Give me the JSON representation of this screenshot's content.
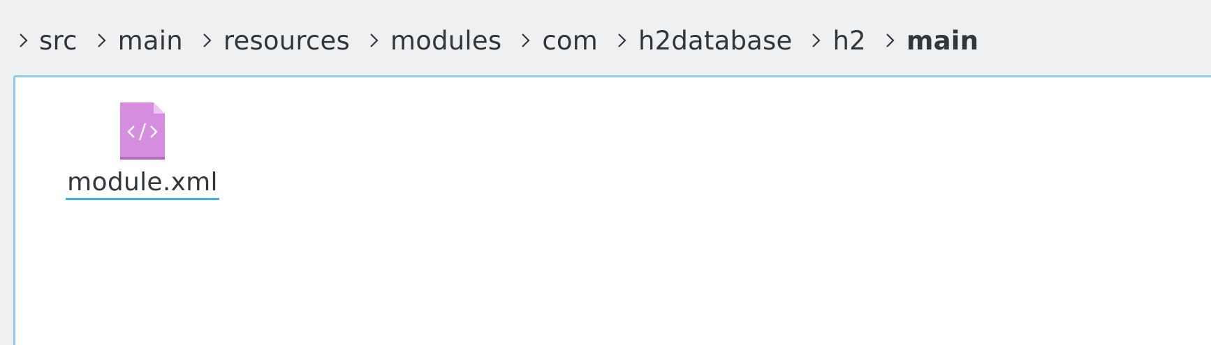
{
  "breadcrumb": {
    "items": [
      {
        "label": "src"
      },
      {
        "label": "main"
      },
      {
        "label": "resources"
      },
      {
        "label": "modules"
      },
      {
        "label": "com"
      },
      {
        "label": "h2database"
      },
      {
        "label": "h2"
      },
      {
        "label": "main"
      }
    ]
  },
  "files": [
    {
      "name": "module.xml",
      "icon": "xml-file-icon",
      "icon_color": "#d68cdf"
    }
  ],
  "colors": {
    "accent": "#3daee9",
    "view_border": "#93cee9",
    "text": "#31363b",
    "background": "#eff0f1"
  }
}
